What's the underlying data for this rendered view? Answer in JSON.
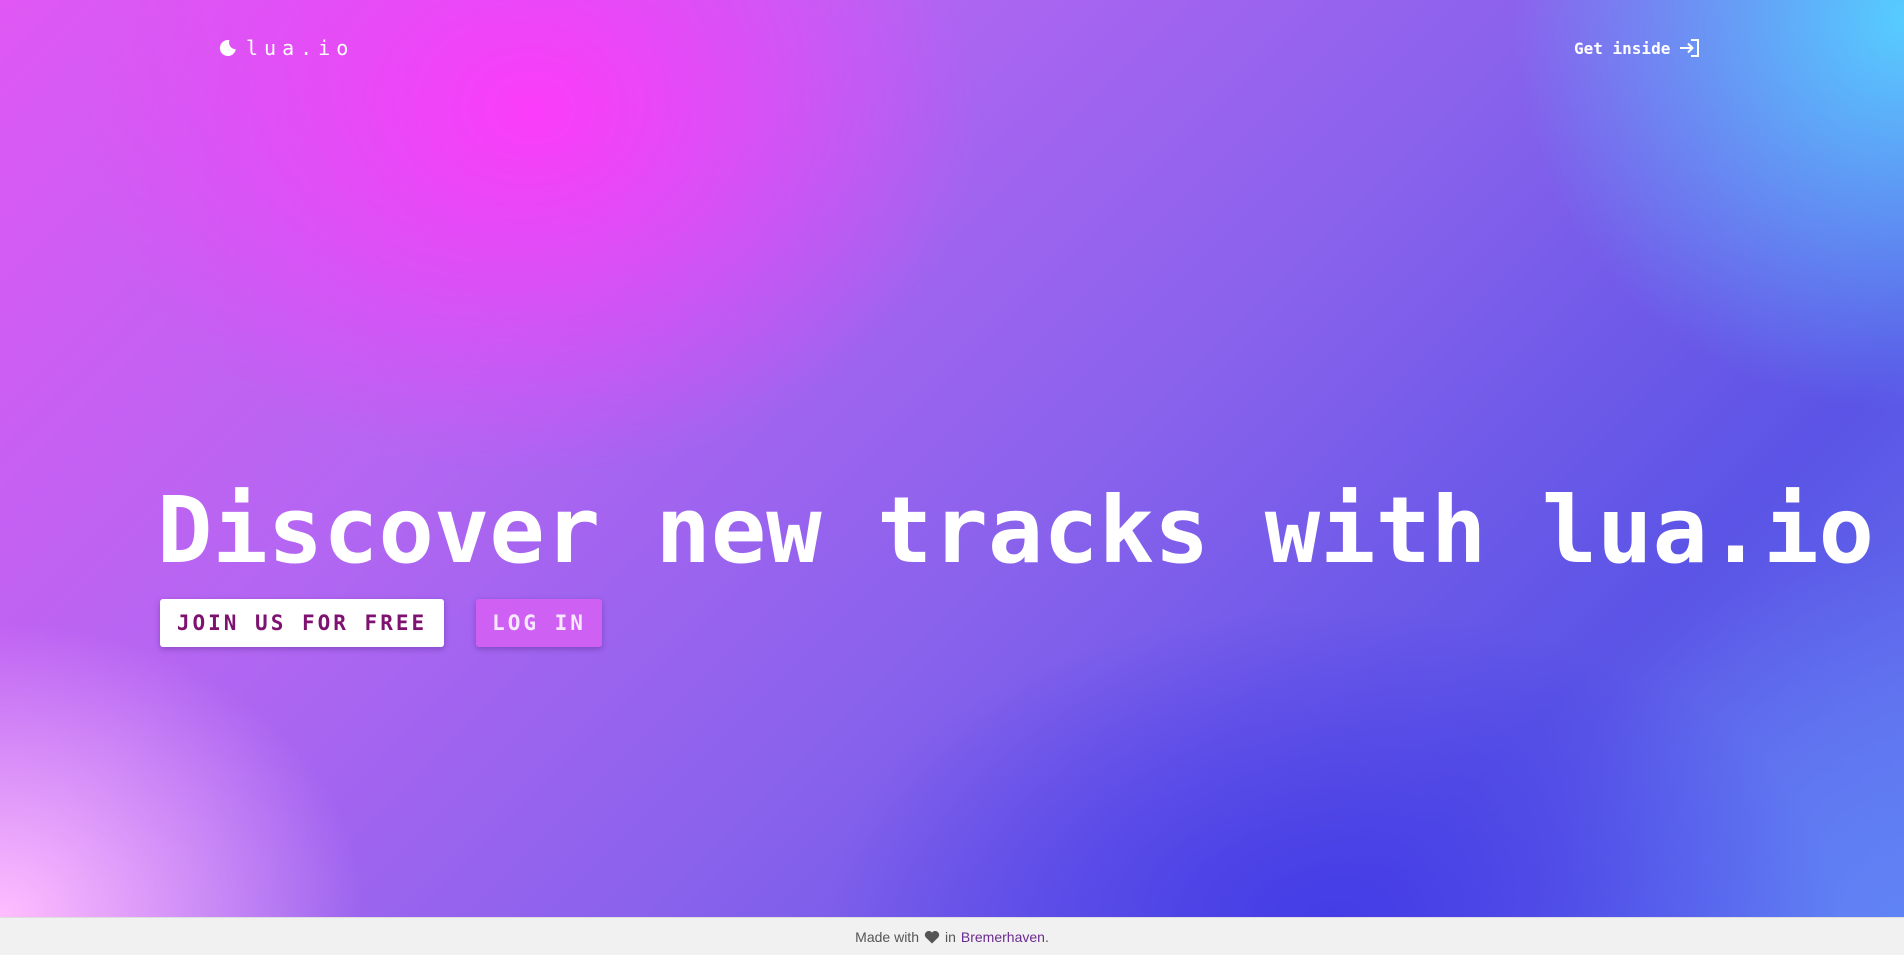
{
  "nav": {
    "logo_icon": "moon-icon",
    "logo_text": "lua.io",
    "cta_label": "Get inside",
    "cta_icon": "sign-in-icon"
  },
  "hero": {
    "headline": "Discover new tracks with lua.io",
    "join_label": "JOIN US FOR FREE",
    "login_label": "LOG IN"
  },
  "footer": {
    "prefix": "Made with",
    "heart_icon": "heart-icon",
    "mid": "in",
    "city": "Bremerhaven",
    "suffix": "."
  },
  "colors": {
    "join_text": "#7e1270",
    "footer_link": "#6b2b8f",
    "footer_bg": "#f1f1f1"
  }
}
